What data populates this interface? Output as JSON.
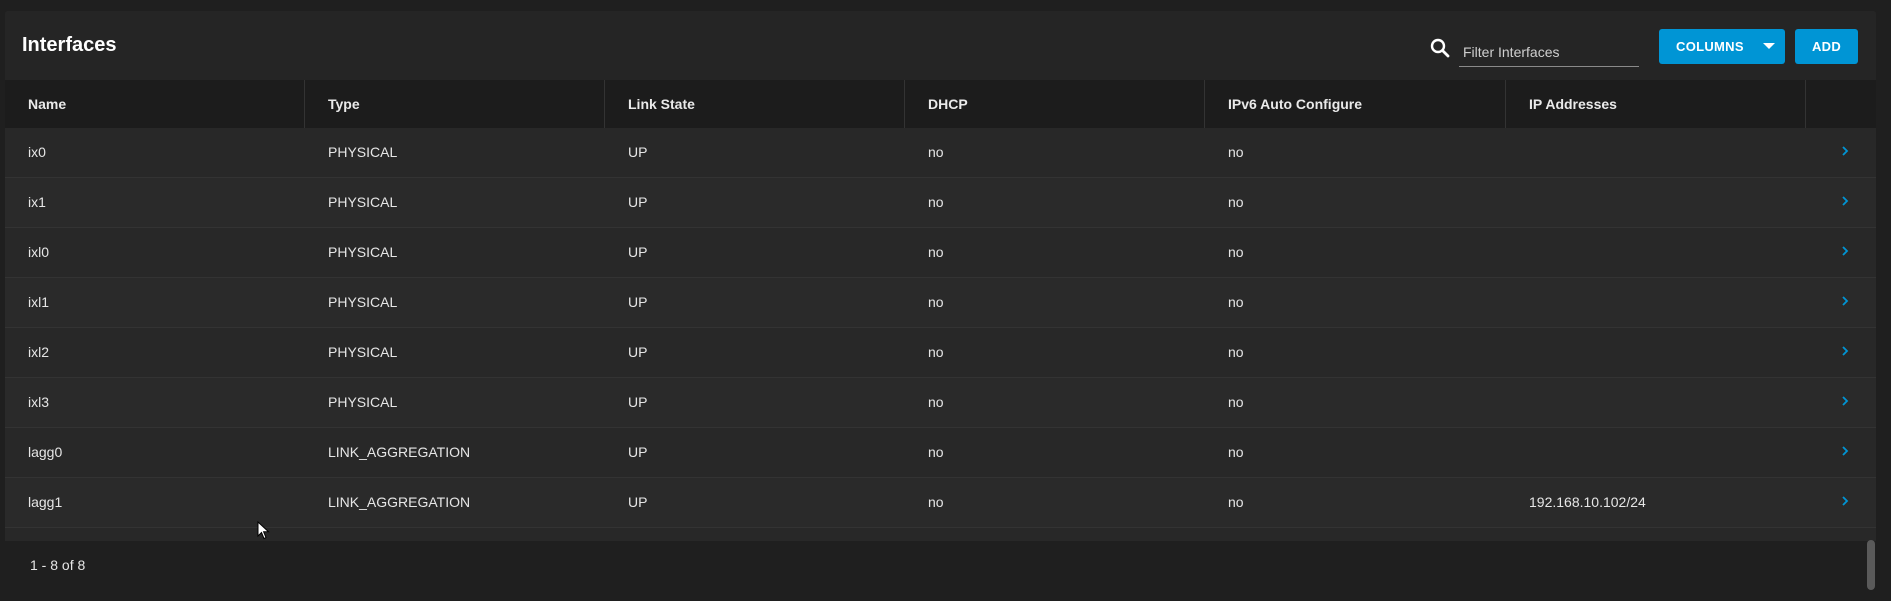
{
  "header": {
    "title": "Interfaces",
    "search_icon": "search-icon",
    "filter_placeholder": "Filter Interfaces",
    "columns_label": "COLUMNS",
    "add_label": "ADD"
  },
  "table": {
    "columns": [
      "Name",
      "Type",
      "Link State",
      "DHCP",
      "IPv6 Auto Configure",
      "IP Addresses"
    ],
    "rows": [
      {
        "name": "ix0",
        "type": "PHYSICAL",
        "link_state": "UP",
        "dhcp": "no",
        "ipv6": "no",
        "ip": ""
      },
      {
        "name": "ix1",
        "type": "PHYSICAL",
        "link_state": "UP",
        "dhcp": "no",
        "ipv6": "no",
        "ip": ""
      },
      {
        "name": "ixl0",
        "type": "PHYSICAL",
        "link_state": "UP",
        "dhcp": "no",
        "ipv6": "no",
        "ip": ""
      },
      {
        "name": "ixl1",
        "type": "PHYSICAL",
        "link_state": "UP",
        "dhcp": "no",
        "ipv6": "no",
        "ip": ""
      },
      {
        "name": "ixl2",
        "type": "PHYSICAL",
        "link_state": "UP",
        "dhcp": "no",
        "ipv6": "no",
        "ip": ""
      },
      {
        "name": "ixl3",
        "type": "PHYSICAL",
        "link_state": "UP",
        "dhcp": "no",
        "ipv6": "no",
        "ip": ""
      },
      {
        "name": "lagg0",
        "type": "LINK_AGGREGATION",
        "link_state": "UP",
        "dhcp": "no",
        "ipv6": "no",
        "ip": ""
      },
      {
        "name": "lagg1",
        "type": "LINK_AGGREGATION",
        "link_state": "UP",
        "dhcp": "no",
        "ipv6": "no",
        "ip": "192.168.10.102/24"
      }
    ]
  },
  "footer": {
    "paginator": "1 - 8 of 8"
  },
  "colors": {
    "accent": "#0095d5",
    "background": "#1f1f1f",
    "card": "#282828"
  }
}
